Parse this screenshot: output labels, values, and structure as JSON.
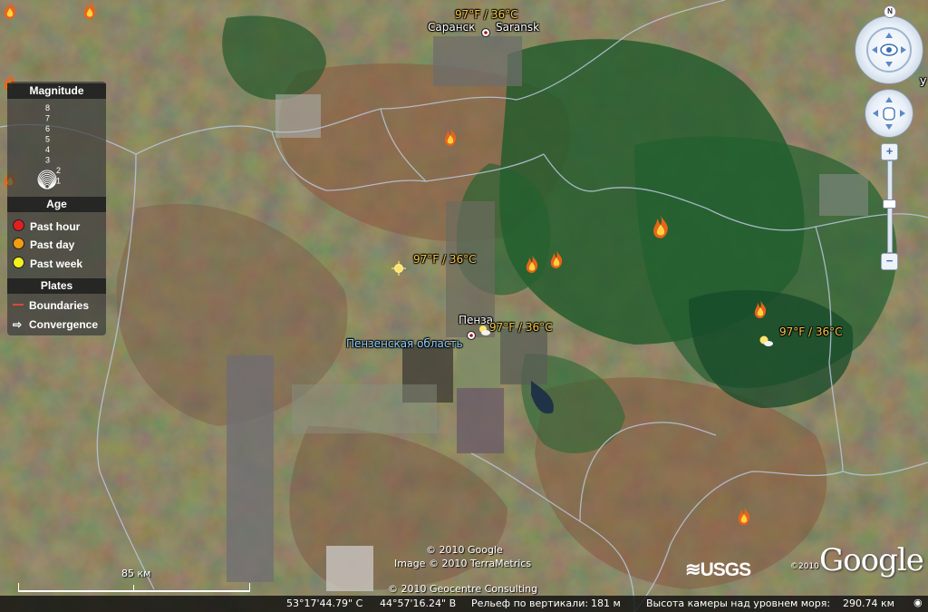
{
  "map": {
    "cities": [
      {
        "name_local": "Саранск",
        "name_en": "Saransk"
      },
      {
        "name": "Пенза"
      }
    ],
    "region_label": "Пензенская область",
    "weather_labels": [
      "97°F / 36°C",
      "97°F / 36°C",
      "97°F / 36°C",
      "97°F / 36°C"
    ],
    "fire_icon_count": 10,
    "edge_label": "У"
  },
  "legend": {
    "magnitude_title": "Magnitude",
    "magnitude_scale": [
      "8",
      "7",
      "6",
      "5",
      "4",
      "3",
      "2",
      "1"
    ],
    "age_title": "Age",
    "age_items": [
      {
        "label": "Past hour",
        "color": "#e21f1f"
      },
      {
        "label": "Past day",
        "color": "#f39c12"
      },
      {
        "label": "Past week",
        "color": "#f5f11a"
      }
    ],
    "plates_title": "Plates",
    "plates_items": [
      {
        "label": "Boundaries",
        "color": "#d94a3a",
        "icon": "red-line-icon"
      },
      {
        "label": "Convergence",
        "icon": "arrow-right-icon"
      }
    ]
  },
  "navigation": {
    "north_label": "N"
  },
  "scale_bar": {
    "label": "85 км"
  },
  "credits": {
    "line1": "© 2010 Google",
    "line2": "Image © 2010 TerraMetrics",
    "line3": "© 2010 Geocentre Consulting",
    "usgs": "USGS",
    "year": "©2010",
    "google": "Google"
  },
  "status_bar": {
    "lat": "53°17'44.79\" С",
    "lon": "44°57'16.24\" В",
    "elevation_label": "Рельеф по вертикали:",
    "elevation_value": "181 м",
    "camera_label": "Высота камеры над уровнем моря:",
    "camera_value": "290.74 км"
  },
  "colors": {
    "weather_text": "#f6c344",
    "region_text": "#8fd0ff",
    "boundary_lines": "#b9c7dd"
  }
}
